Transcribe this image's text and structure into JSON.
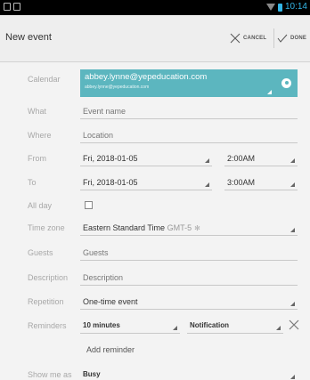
{
  "status_bar": {
    "time": "10:14"
  },
  "action_bar": {
    "title": "New event",
    "cancel_label": "CANCEL",
    "done_label": "DONE"
  },
  "calendar": {
    "label": "Calendar",
    "account": "abbey.lynne@yepeducation.com",
    "account_sub": "abbey.lynne@yepeducation.com"
  },
  "what": {
    "label": "What",
    "placeholder": "Event name"
  },
  "where": {
    "label": "Where",
    "placeholder": "Location"
  },
  "from": {
    "label": "From",
    "date": "Fri, 2018-01-05",
    "time": "2:00AM"
  },
  "to": {
    "label": "To",
    "date": "Fri, 2018-01-05",
    "time": "3:00AM"
  },
  "all_day": {
    "label": "All day",
    "checked": false
  },
  "time_zone": {
    "label": "Time zone",
    "name": "Eastern Standard Time",
    "offset": "GMT-5"
  },
  "guests": {
    "label": "Guests",
    "placeholder": "Guests"
  },
  "description": {
    "label": "Description",
    "placeholder": "Description"
  },
  "repetition": {
    "label": "Repetition",
    "value": "One-time event"
  },
  "reminders": {
    "label": "Reminders",
    "time": "10 minutes",
    "method": "Notification",
    "add_label": "Add reminder"
  },
  "show_me_as": {
    "label": "Show me as",
    "value": "Busy"
  },
  "colors": {
    "accent": "#33b5e5",
    "calendar": "#5cb6bf"
  }
}
